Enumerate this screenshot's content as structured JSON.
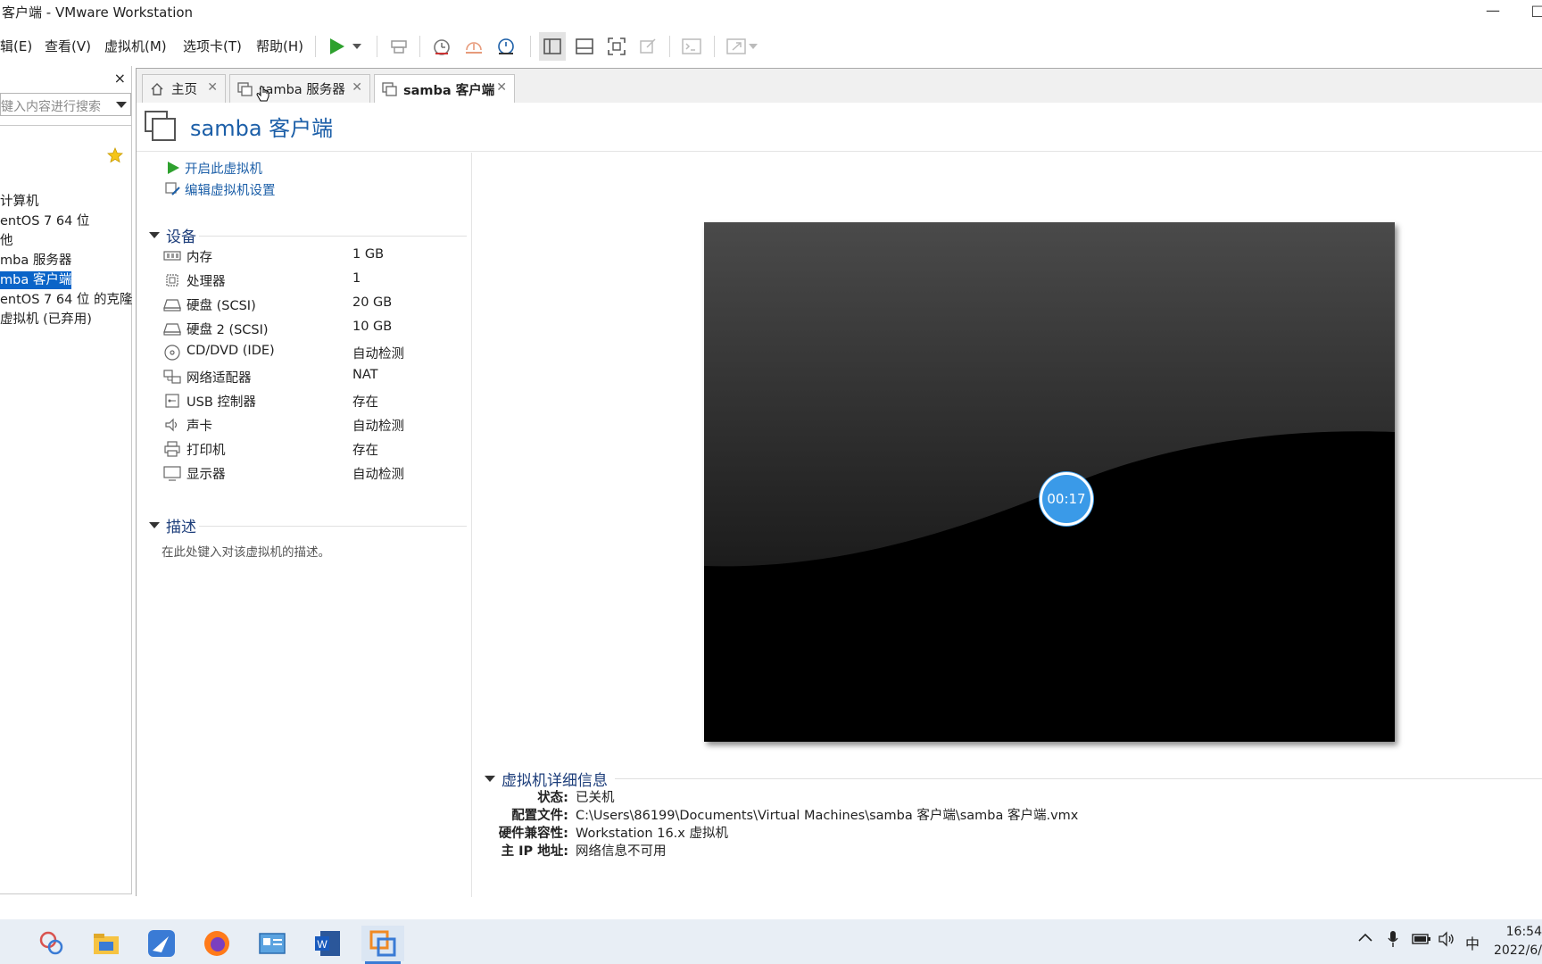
{
  "window": {
    "title": "客户端 - VMware Workstation",
    "minimize": "—",
    "maximize": "□"
  },
  "menu": {
    "edit": "辑(E)",
    "view": "查看(V)",
    "vm": "虚拟机(M)",
    "tabs": "选项卡(T)",
    "help": "帮助(H)"
  },
  "sidebar": {
    "close": "×",
    "search_placeholder": "键入内容进行搜索",
    "items": [
      {
        "label": "计算机"
      },
      {
        "label": "entOS 7 64 位"
      },
      {
        "label": "他"
      },
      {
        "label": "mba 服务器"
      },
      {
        "label": "mba 客户端"
      },
      {
        "label": "entOS 7 64 位 的克隆"
      },
      {
        "label": "虚拟机 (已弃用)"
      }
    ],
    "selected_index": 4
  },
  "tabs": [
    {
      "label": "主页",
      "icon": "home-icon"
    },
    {
      "label": "samba 服务器",
      "icon": "vm-icon"
    },
    {
      "label": "samba 客户端",
      "icon": "vm-icon",
      "active": true
    }
  ],
  "vm": {
    "title": "samba 客户端",
    "actions": {
      "power_on": "开启此虚拟机",
      "edit_settings": "编辑虚拟机设置"
    },
    "devices_heading": "设备",
    "devices": [
      {
        "name": "内存",
        "value": "1 GB",
        "icon": "memory-icon"
      },
      {
        "name": "处理器",
        "value": "1",
        "icon": "cpu-icon"
      },
      {
        "name": "硬盘 (SCSI)",
        "value": "20 GB",
        "icon": "disk-icon"
      },
      {
        "name": "硬盘 2 (SCSI)",
        "value": "10 GB",
        "icon": "disk-icon"
      },
      {
        "name": "CD/DVD (IDE)",
        "value": "自动检测",
        "icon": "cd-icon"
      },
      {
        "name": "网络适配器",
        "value": "NAT",
        "icon": "network-icon"
      },
      {
        "name": "USB 控制器",
        "value": "存在",
        "icon": "usb-icon"
      },
      {
        "name": "声卡",
        "value": "自动检测",
        "icon": "sound-icon"
      },
      {
        "name": "打印机",
        "value": "存在",
        "icon": "printer-icon"
      },
      {
        "name": "显示器",
        "value": "自动检测",
        "icon": "display-icon"
      }
    ],
    "description_heading": "描述",
    "description_placeholder": "在此处键入对该虚拟机的描述。",
    "preview_timer": "00:17",
    "details_heading": "虚拟机详细信息",
    "details": [
      {
        "label": "状态:",
        "value": "已关机"
      },
      {
        "label": "配置文件:",
        "value": "C:\\Users\\86199\\Documents\\Virtual Machines\\samba 客户端\\samba 客户端.vmx"
      },
      {
        "label": "硬件兼容性:",
        "value": "Workstation 16.x 虚拟机"
      },
      {
        "label": "主 IP 地址:",
        "value": "网络信息不可用"
      }
    ]
  },
  "taskbar": {
    "apps": [
      "snipping-app-icon",
      "file-explorer-icon",
      "feishu-icon",
      "firefox-icon",
      "control-panel-icon",
      "word-icon",
      "vmware-icon"
    ],
    "tray_ime": "中",
    "clock_time": "16:54",
    "clock_date": "2022/6/"
  },
  "colors": {
    "accent": "#1c5fa8",
    "selection": "#0a64c8",
    "play_green": "#2ea12e"
  }
}
